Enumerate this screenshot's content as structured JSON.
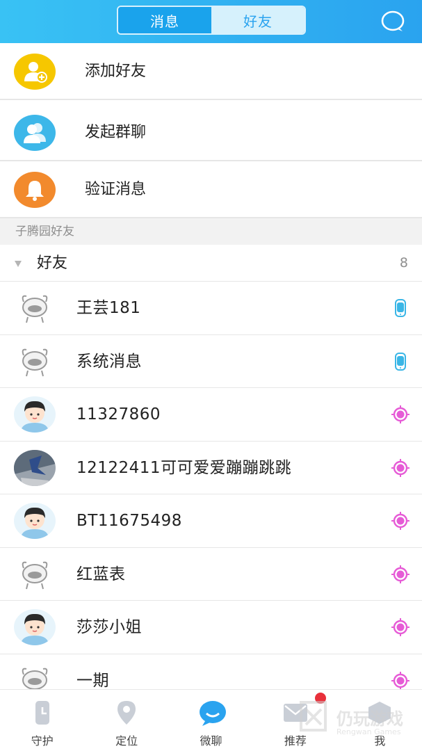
{
  "header": {
    "tabs": [
      {
        "label": "消息",
        "active": true
      },
      {
        "label": "好友",
        "active": false
      }
    ],
    "chat_icon": "chat-bubble-icon"
  },
  "actions": [
    {
      "label": "添加好友",
      "icon": "add-friend-icon",
      "color": "#f6c700"
    },
    {
      "label": "发起群聊",
      "icon": "group-chat-icon",
      "color": "#3db7e9"
    },
    {
      "label": "验证消息",
      "icon": "bell-icon",
      "color": "#f28a2d"
    }
  ],
  "group": {
    "section_title": "子腾园好友",
    "title": "好友",
    "count": "8"
  },
  "friends": [
    {
      "name": "王芸181",
      "avatar": "robot-avatar",
      "device": "watch",
      "device_color": "#3ab6e6"
    },
    {
      "name": "系统消息",
      "avatar": "robot-avatar",
      "device": "watch",
      "device_color": "#3ab6e6"
    },
    {
      "name": "11327860",
      "avatar": "boy-avatar",
      "device": "flower",
      "device_color": "#e65bd6"
    },
    {
      "name": "12122411可可爱爱蹦蹦跳跳",
      "avatar": "photo-avatar",
      "device": "flower",
      "device_color": "#e65bd6"
    },
    {
      "name": "BT11675498",
      "avatar": "boy-avatar",
      "device": "flower",
      "device_color": "#e65bd6"
    },
    {
      "name": "红蓝表",
      "avatar": "robot-avatar",
      "device": "flower",
      "device_color": "#e65bd6"
    },
    {
      "name": "莎莎小姐",
      "avatar": "boy-avatar",
      "device": "flower",
      "device_color": "#e65bd6"
    },
    {
      "name": "一期",
      "avatar": "robot-avatar",
      "device": "flower",
      "device_color": "#e65bd6"
    }
  ],
  "bottom_nav": [
    {
      "label": "守护",
      "icon": "watch-icon",
      "active": false
    },
    {
      "label": "定位",
      "icon": "location-pin-icon",
      "active": false
    },
    {
      "label": "微聊",
      "icon": "chat-icon",
      "active": true
    },
    {
      "label": "推荐",
      "icon": "mail-icon",
      "active": false,
      "badge": true
    },
    {
      "label": "我",
      "icon": "profile-icon",
      "active": false
    }
  ],
  "watermark": {
    "title": "仍玩游戏",
    "subtitle": "Rengwan Games"
  },
  "colors": {
    "accent": "#2aa3ef",
    "inactive_icon": "#c9ced6",
    "badge": "#e8303a"
  }
}
